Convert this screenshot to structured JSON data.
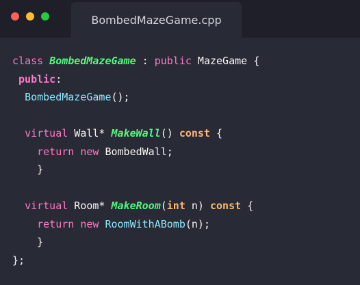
{
  "window": {
    "tab_title": "BombedMazeGame.cpp",
    "controls": [
      "close-dot",
      "minimize-dot",
      "maximize-dot"
    ]
  },
  "code": {
    "lines": [
      [
        {
          "t": "class ",
          "c": "kw"
        },
        {
          "t": "BombedMazeGame",
          "c": "cls"
        },
        {
          "t": " : ",
          "c": "pl"
        },
        {
          "t": "public",
          "c": "kw"
        },
        {
          "t": " MazeGame {",
          "c": "pl"
        }
      ],
      [
        {
          "t": " public",
          "c": "kwb"
        },
        {
          "t": ":",
          "c": "pl"
        }
      ],
      [
        {
          "t": "  ",
          "c": "pl"
        },
        {
          "t": "BombedMazeGame",
          "c": "fn"
        },
        {
          "t": "();",
          "c": "pl"
        }
      ],
      [
        {
          "t": "",
          "c": "pl"
        }
      ],
      [
        {
          "t": "  ",
          "c": "pl"
        },
        {
          "t": "virtual",
          "c": "kw"
        },
        {
          "t": " Wall* ",
          "c": "pl"
        },
        {
          "t": "MakeWall",
          "c": "cls"
        },
        {
          "t": "() ",
          "c": "pl"
        },
        {
          "t": "const",
          "c": "ty"
        },
        {
          "t": " {",
          "c": "pl"
        }
      ],
      [
        {
          "t": "    ",
          "c": "pl"
        },
        {
          "t": "return",
          "c": "kw"
        },
        {
          "t": " ",
          "c": "pl"
        },
        {
          "t": "new",
          "c": "kw"
        },
        {
          "t": " BombedWall;",
          "c": "pl"
        }
      ],
      [
        {
          "t": "    }",
          "c": "pl"
        }
      ],
      [
        {
          "t": "",
          "c": "pl"
        }
      ],
      [
        {
          "t": "  ",
          "c": "pl"
        },
        {
          "t": "virtual",
          "c": "kw"
        },
        {
          "t": " Room* ",
          "c": "pl"
        },
        {
          "t": "MakeRoom",
          "c": "cls"
        },
        {
          "t": "(",
          "c": "pl"
        },
        {
          "t": "int",
          "c": "ty"
        },
        {
          "t": " n) ",
          "c": "pl"
        },
        {
          "t": "const",
          "c": "ty"
        },
        {
          "t": " {",
          "c": "pl"
        }
      ],
      [
        {
          "t": "    ",
          "c": "pl"
        },
        {
          "t": "return",
          "c": "kw"
        },
        {
          "t": " ",
          "c": "pl"
        },
        {
          "t": "new",
          "c": "kw"
        },
        {
          "t": " ",
          "c": "pl"
        },
        {
          "t": "RoomWithABomb",
          "c": "fn"
        },
        {
          "t": "(n);",
          "c": "pl"
        }
      ],
      [
        {
          "t": "    }",
          "c": "pl"
        }
      ],
      [
        {
          "t": "};",
          "c": "pl"
        }
      ]
    ]
  },
  "colors": {
    "background": "#282a36",
    "titlebar": "#1e1f29",
    "keyword": "#ff79c6",
    "class_name": "#50fa7b",
    "function_call": "#8be9fd",
    "type_keyword": "#ffb86c",
    "plain": "#f8f8f2"
  }
}
